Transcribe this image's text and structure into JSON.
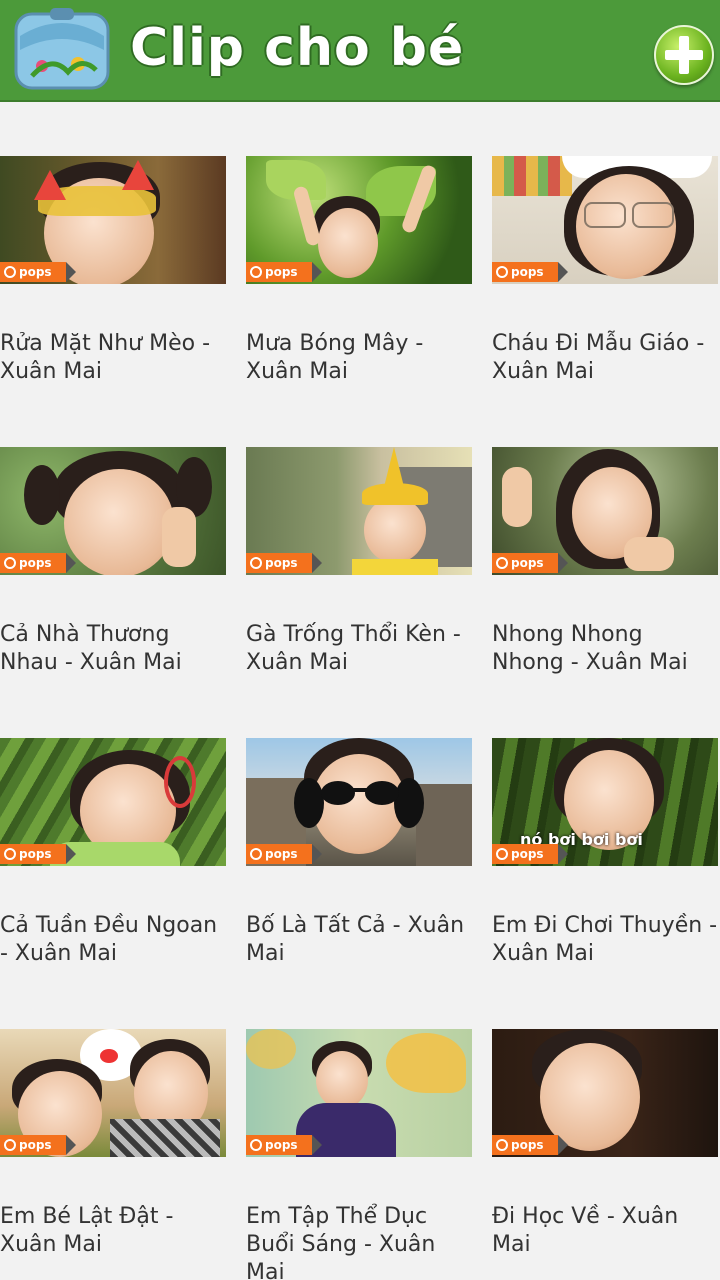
{
  "app": {
    "title": "Clip cho bé"
  },
  "icons": {
    "logo": "backpack-logo-icon",
    "add": "plus-circle-icon",
    "badge": "pops-badge-icon"
  },
  "colors": {
    "appbar": "#4c9a3a",
    "badge": "#f4711d",
    "background": "#f2f2f2"
  },
  "badge_label": "pops",
  "videos": [
    {
      "caption": "Rửa Mặt Như Mèo - Xuân Mai"
    },
    {
      "caption": "Mưa Bóng Mây - Xuân Mai"
    },
    {
      "caption": "Cháu Đi Mẫu Giáo - Xuân Mai"
    },
    {
      "caption": "Cả Nhà Thương Nhau - Xuân Mai"
    },
    {
      "caption": "Gà Trống Thổi Kèn - Xuân Mai"
    },
    {
      "caption": "Nhong Nhong Nhong - Xuân Mai"
    },
    {
      "caption": "Cả Tuần Đều Ngoan - Xuân Mai"
    },
    {
      "caption": "Bố Là Tất Cả - Xuân Mai"
    },
    {
      "caption": "Em Đi Chơi Thuyền - Xuân Mai",
      "overlay": "nó bơi bơi bơi"
    },
    {
      "caption": "Em Bé Lật Đật - Xuân Mai"
    },
    {
      "caption": "Em Tập Thể Dục Buổi Sáng - Xuân Mai"
    },
    {
      "caption": "Đi Học Về - Xuân Mai"
    }
  ]
}
